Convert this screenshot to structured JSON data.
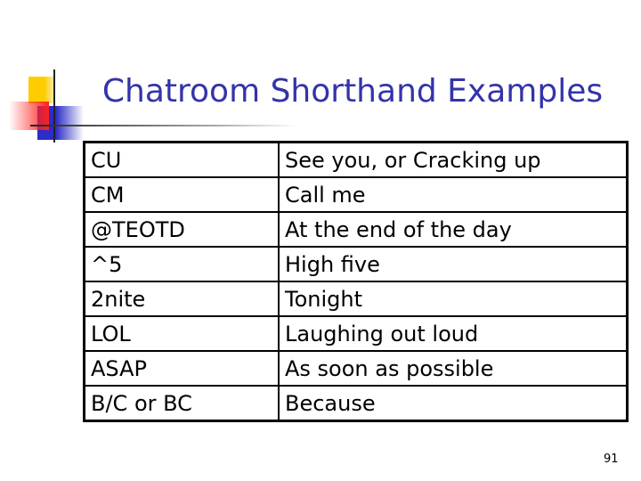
{
  "title": "Chatroom Shorthand Examples",
  "rows": [
    {
      "abbr": "CU",
      "meaning": "See you, or Cracking up"
    },
    {
      "abbr": "CM",
      "meaning": "Call me"
    },
    {
      "abbr": "@TEOTD",
      "meaning": "At the end of the day"
    },
    {
      "abbr": "^5",
      "meaning": "High five"
    },
    {
      "abbr": "2nite",
      "meaning": "Tonight"
    },
    {
      "abbr": "LOL",
      "meaning": "Laughing out loud"
    },
    {
      "abbr": "ASAP",
      "meaning": "As soon as possible"
    },
    {
      "abbr": "B/C or BC",
      "meaning": "Because"
    }
  ],
  "page_number": "91",
  "colors": {
    "title": "#3333aa"
  }
}
